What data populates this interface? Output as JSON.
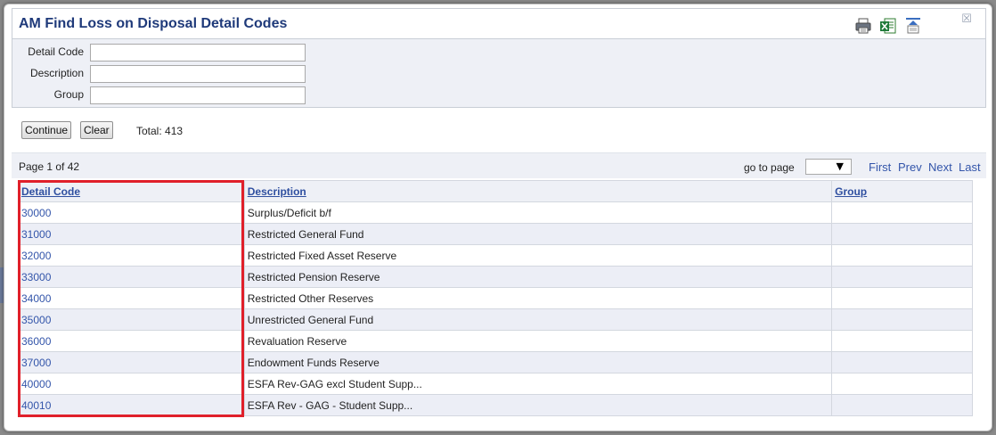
{
  "window": {
    "title": "AM Find Loss on Disposal Detail Codes",
    "icons": [
      "print-icon",
      "excel-export-icon",
      "collapse-icon",
      "close-icon"
    ]
  },
  "filters": {
    "detail_code_label": "Detail Code",
    "detail_code_value": "",
    "description_label": "Description",
    "description_value": "",
    "group_label": "Group",
    "group_value": ""
  },
  "actions": {
    "continue_label": "Continue",
    "clear_label": "Clear",
    "total_text": "Total: 413"
  },
  "pager": {
    "page_info": "Page 1 of 42",
    "goto_label": "go to page",
    "goto_value": "",
    "first": "First",
    "prev": "Prev",
    "next": "Next",
    "last": "Last"
  },
  "table": {
    "columns": [
      "Detail Code",
      "Description",
      "Group"
    ],
    "rows": [
      {
        "code": "30000",
        "description": "Surplus/Deficit b/f",
        "group": ""
      },
      {
        "code": "31000",
        "description": "Restricted General Fund",
        "group": ""
      },
      {
        "code": "32000",
        "description": "Restricted Fixed Asset Reserve",
        "group": ""
      },
      {
        "code": "33000",
        "description": "Restricted Pension Reserve",
        "group": ""
      },
      {
        "code": "34000",
        "description": "Restricted Other Reserves",
        "group": ""
      },
      {
        "code": "35000",
        "description": "Unrestricted General Fund",
        "group": ""
      },
      {
        "code": "36000",
        "description": "Revaluation Reserve",
        "group": ""
      },
      {
        "code": "37000",
        "description": "Endowment Funds Reserve",
        "group": ""
      },
      {
        "code": "40000",
        "description": "ESFA Rev-GAG excl Student Supp...",
        "group": ""
      },
      {
        "code": "40010",
        "description": "ESFA Rev - GAG - Student Supp...",
        "group": ""
      }
    ]
  },
  "colors": {
    "title": "#1f3a7a",
    "link": "#3355aa",
    "panel": "#eef0f6",
    "highlight": "#e0202a"
  }
}
